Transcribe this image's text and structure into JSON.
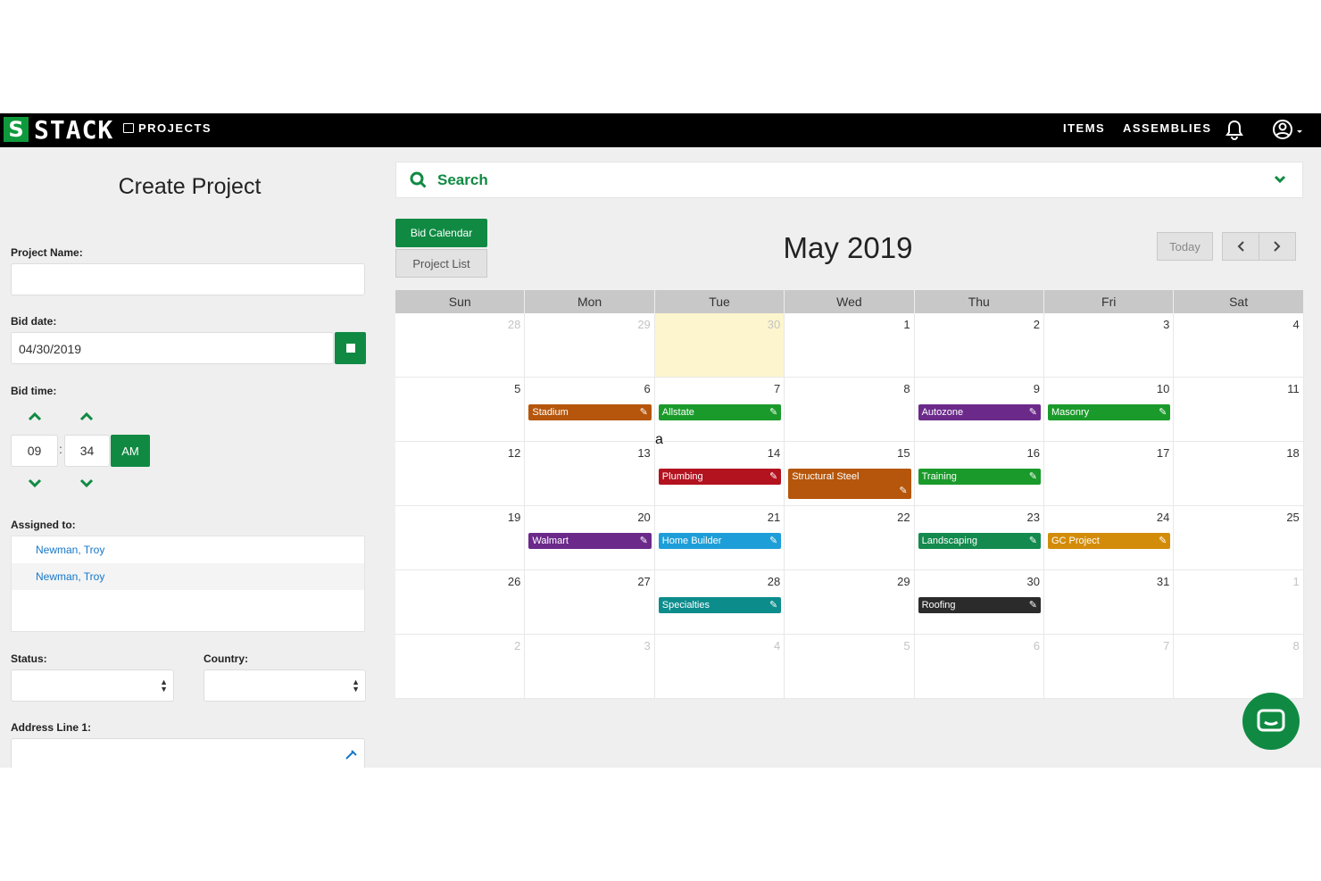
{
  "topbar": {
    "logo_text": "STACK",
    "nav_projects": "PROJECTS",
    "nav_items": "ITEMS",
    "nav_assemblies": "ASSEMBLIES"
  },
  "form": {
    "title": "Create Project",
    "project_name_label": "Project Name:",
    "project_name_value": "",
    "bid_date_label": "Bid date:",
    "bid_date_value": "04/30/2019",
    "bid_time_label": "Bid time:",
    "hour": "09",
    "minute": "34",
    "ampm": "AM",
    "assigned_label": "Assigned to:",
    "assigned": [
      "Newman, Troy",
      "Newman, Troy"
    ],
    "status_label": "Status:",
    "country_label": "Country:",
    "address_label": "Address Line 1:"
  },
  "search": {
    "label": "Search"
  },
  "calendar": {
    "title": "May 2019",
    "bid_calendar_label": "Bid Calendar",
    "project_list_label": "Project List",
    "today_label": "Today",
    "days": [
      "Sun",
      "Mon",
      "Tue",
      "Wed",
      "Thu",
      "Fri",
      "Sat"
    ],
    "weeks": [
      [
        {
          "n": "28",
          "m": true
        },
        {
          "n": "29",
          "m": true
        },
        {
          "n": "30",
          "m": true,
          "today": true
        },
        {
          "n": "1"
        },
        {
          "n": "2"
        },
        {
          "n": "3"
        },
        {
          "n": "4"
        }
      ],
      [
        {
          "n": "5"
        },
        {
          "n": "6"
        },
        {
          "n": "7"
        },
        {
          "n": "8"
        },
        {
          "n": "9"
        },
        {
          "n": "10"
        },
        {
          "n": "11"
        }
      ],
      [
        {
          "n": "12"
        },
        {
          "n": "13"
        },
        {
          "n": "14"
        },
        {
          "n": "15"
        },
        {
          "n": "16"
        },
        {
          "n": "17"
        },
        {
          "n": "18"
        }
      ],
      [
        {
          "n": "19"
        },
        {
          "n": "20"
        },
        {
          "n": "21"
        },
        {
          "n": "22"
        },
        {
          "n": "23"
        },
        {
          "n": "24"
        },
        {
          "n": "25"
        }
      ],
      [
        {
          "n": "26"
        },
        {
          "n": "27"
        },
        {
          "n": "28"
        },
        {
          "n": "29"
        },
        {
          "n": "30"
        },
        {
          "n": "31"
        },
        {
          "n": "1",
          "m": true
        }
      ],
      [
        {
          "n": "2",
          "m": true
        },
        {
          "n": "3",
          "m": true
        },
        {
          "n": "4",
          "m": true
        },
        {
          "n": "5",
          "m": true
        },
        {
          "n": "6",
          "m": true
        },
        {
          "n": "7",
          "m": true
        },
        {
          "n": "8",
          "m": true
        }
      ]
    ],
    "events": [
      {
        "label": "Stadium",
        "week": 1,
        "day": 1,
        "color": "#b5560c"
      },
      {
        "label": "Allstate",
        "week": 1,
        "day": 2,
        "color": "#1a9a2a"
      },
      {
        "label": "Autozone",
        "week": 1,
        "day": 4,
        "color": "#6b2a8a"
      },
      {
        "label": "Masonry",
        "week": 1,
        "day": 5,
        "color": "#1a9a2a"
      },
      {
        "label": "Plumbing",
        "week": 2,
        "day": 2,
        "color": "#b3121f"
      },
      {
        "label": "Structural Steel",
        "week": 2,
        "day": 3,
        "color": "#b5560c",
        "tall": true
      },
      {
        "label": "Training",
        "week": 2,
        "day": 4,
        "color": "#1a9a2a"
      },
      {
        "label": "Walmart",
        "week": 3,
        "day": 1,
        "color": "#6b2a8a"
      },
      {
        "label": "Home Builder",
        "week": 3,
        "day": 2,
        "color": "#1e9ed8"
      },
      {
        "label": "Landscaping",
        "week": 3,
        "day": 4,
        "color": "#148a4e"
      },
      {
        "label": "GC Project",
        "week": 3,
        "day": 5,
        "color": "#d38c0a"
      },
      {
        "label": "Specialties",
        "week": 4,
        "day": 2,
        "color": "#0d8c8c"
      },
      {
        "label": "Roofing",
        "week": 4,
        "day": 4,
        "color": "#2b2b2b"
      }
    ],
    "stray_text": "a"
  }
}
